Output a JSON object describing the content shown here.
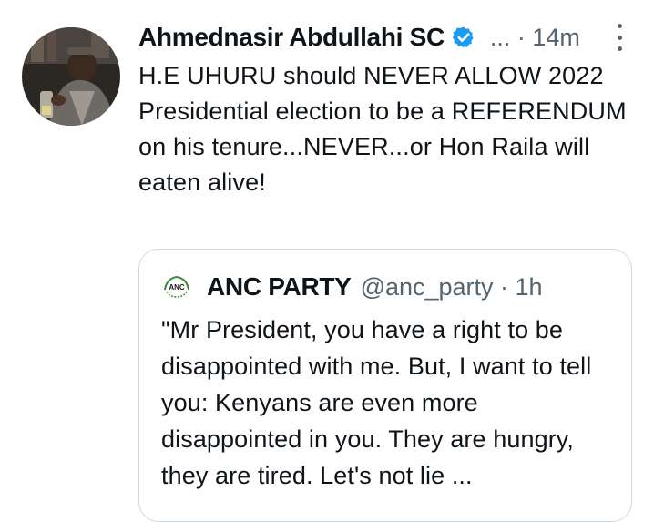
{
  "tweet": {
    "author_name": "Ahmednasir Abdullahi SC",
    "meta": "... · 14m",
    "text": "H.E UHURU should NEVER ALLOW 2022 Presidential election to be a REFERENDUM on his tenure...NEVER...or Hon Raila will eaten alive!"
  },
  "quoted_tweet": {
    "author_name": "ANC PARTY",
    "meta": "@anc_party · 1h",
    "logo_text": "ANC",
    "text": "\"Mr President, you have a right to be disappointed with me. But, I want to tell you: Kenyans are even more disappointed in you. They are hungry, they are tired. Let's not lie ..."
  },
  "icons": {
    "verified": "verified-badge-icon",
    "more": "more-options-icon"
  },
  "colors": {
    "verified_blue": "#1d9bf0",
    "secondary_text": "#536471",
    "border": "#cfd9de",
    "logo_green": "#3a8a3a"
  }
}
